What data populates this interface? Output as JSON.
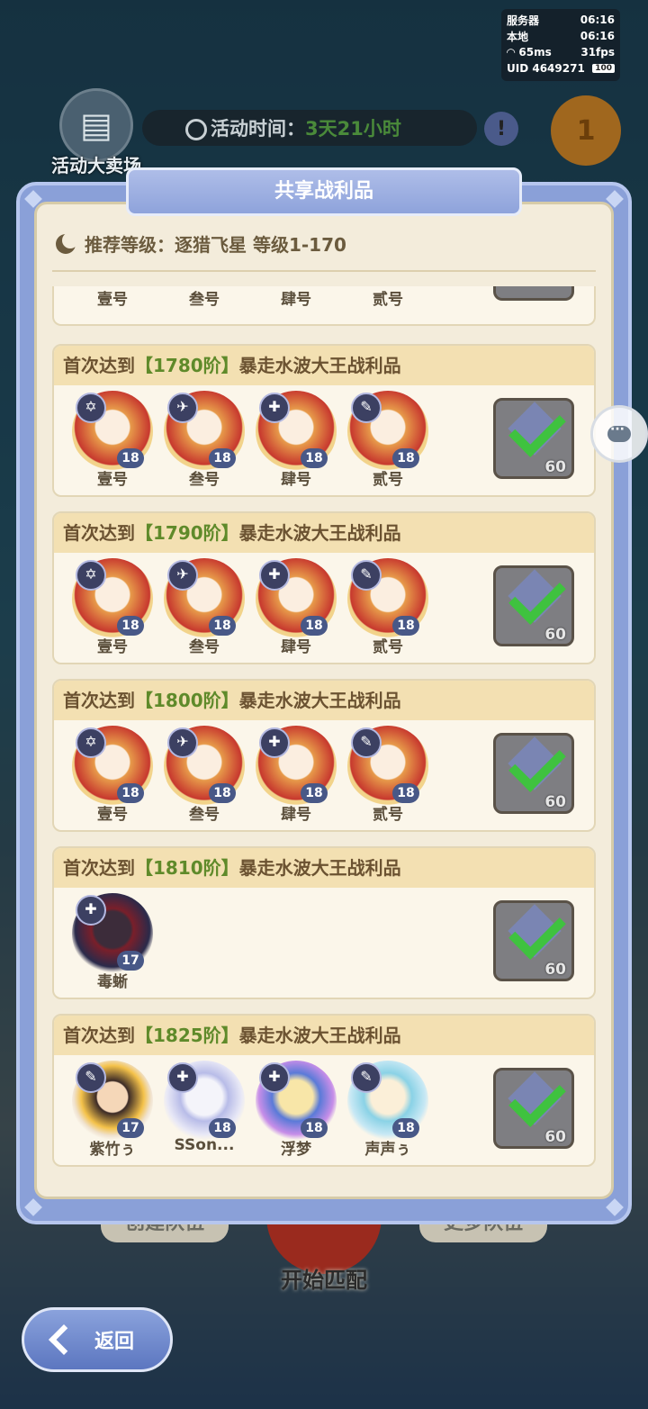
{
  "status": {
    "server_label": "服务器",
    "server_time": "06:16",
    "local_label": "本地",
    "local_time": "06:16",
    "ping": "65ms",
    "fps": "31fps",
    "uid": "UID 4649271",
    "battery": "100"
  },
  "header": {
    "shop_label": "活动大卖场",
    "timer_label": "活动时间：",
    "timer_value": "3天21小时",
    "info_icon": "!",
    "rank_icon": "1"
  },
  "background_buttons": {
    "create_label": "创建队伍",
    "more_label": "更多队伍",
    "match_label": "开始匹配",
    "back_label": "返回"
  },
  "modal": {
    "title": "共享战利品",
    "recommend": "推荐等级：逐猎飞星  等级1-170",
    "partial_names": [
      "壹号",
      "叁号",
      "肆号",
      "贰号"
    ],
    "entries": [
      {
        "prefix": "首次达到",
        "tier": "【1780阶】",
        "suffix": "暴走水波大王战利品",
        "chars": [
          {
            "name": "壹号",
            "level": "18",
            "emblem": "✡",
            "style": ""
          },
          {
            "name": "叁号",
            "level": "18",
            "emblem": "✈",
            "style": ""
          },
          {
            "name": "肆号",
            "level": "18",
            "emblem": "✚",
            "style": ""
          },
          {
            "name": "贰号",
            "level": "18",
            "emblem": "✎",
            "style": ""
          }
        ],
        "reward_count": "60"
      },
      {
        "prefix": "首次达到",
        "tier": "【1790阶】",
        "suffix": "暴走水波大王战利品",
        "chars": [
          {
            "name": "壹号",
            "level": "18",
            "emblem": "✡",
            "style": ""
          },
          {
            "name": "叁号",
            "level": "18",
            "emblem": "✈",
            "style": ""
          },
          {
            "name": "肆号",
            "level": "18",
            "emblem": "✚",
            "style": ""
          },
          {
            "name": "贰号",
            "level": "18",
            "emblem": "✎",
            "style": ""
          }
        ],
        "reward_count": "60"
      },
      {
        "prefix": "首次达到",
        "tier": "【1800阶】",
        "suffix": "暴走水波大王战利品",
        "chars": [
          {
            "name": "壹号",
            "level": "18",
            "emblem": "✡",
            "style": ""
          },
          {
            "name": "叁号",
            "level": "18",
            "emblem": "✈",
            "style": ""
          },
          {
            "name": "肆号",
            "level": "18",
            "emblem": "✚",
            "style": ""
          },
          {
            "name": "贰号",
            "level": "18",
            "emblem": "✎",
            "style": ""
          }
        ],
        "reward_count": "60"
      },
      {
        "prefix": "首次达到",
        "tier": "【1810阶】",
        "suffix": "暴走水波大王战利品",
        "chars": [
          {
            "name": "毒蜥",
            "level": "17",
            "emblem": "✚",
            "style": "dark"
          }
        ],
        "reward_count": "60"
      },
      {
        "prefix": "首次达到",
        "tier": "【1825阶】",
        "suffix": "暴走水波大王战利品",
        "chars": [
          {
            "name": "紫竹ぅ",
            "level": "17",
            "emblem": "✎",
            "style": "cat"
          },
          {
            "name": "SSon...",
            "level": "18",
            "emblem": "✚",
            "style": "silver"
          },
          {
            "name": "浮梦",
            "level": "18",
            "emblem": "✚",
            "style": "blue"
          },
          {
            "name": "声声ぅ",
            "level": "18",
            "emblem": "✎",
            "style": "aqua"
          }
        ],
        "reward_count": "60"
      }
    ]
  },
  "icons": {
    "shop": "shop-icon",
    "timer": "clock-icon",
    "chat": "chat-icon",
    "back": "back-arrow-icon",
    "reward": "crystal-icon",
    "claimed": "checkmark-icon",
    "recommend": "moon-icon"
  },
  "colors": {
    "tier_green": "#5f8a2a",
    "modal_blue": "#8aa0d8",
    "card_header": "#f3e0b2",
    "check_green": "#3fc23f"
  }
}
